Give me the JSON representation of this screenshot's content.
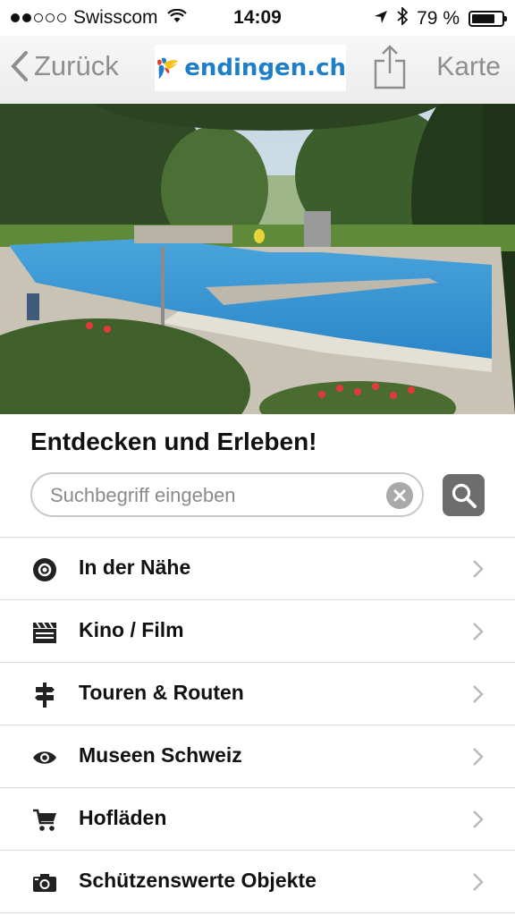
{
  "status_bar": {
    "carrier": "Swisscom",
    "time": "14:09",
    "battery_percent": "79 %",
    "battery_level": 0.79,
    "signal_bars_filled": 2
  },
  "nav": {
    "back_label": "Zurück",
    "logo_text": "endingen.ch",
    "map_label": "Karte",
    "brand_color": "#1e7fc8"
  },
  "main": {
    "heading": "Entdecken und Erleben!",
    "search": {
      "placeholder": "Suchbegriff eingeben",
      "value": ""
    }
  },
  "menu": [
    {
      "label": "In der Nähe",
      "icon": "location-target-icon"
    },
    {
      "label": "Kino / Film",
      "icon": "clapperboard-icon"
    },
    {
      "label": "Touren & Routen",
      "icon": "signpost-icon"
    },
    {
      "label": "Museen Schweiz",
      "icon": "eye-icon"
    },
    {
      "label": "Hofläden",
      "icon": "shopping-cart-icon"
    },
    {
      "label": "Schützenswerte Objekte",
      "icon": "camera-icon"
    }
  ]
}
